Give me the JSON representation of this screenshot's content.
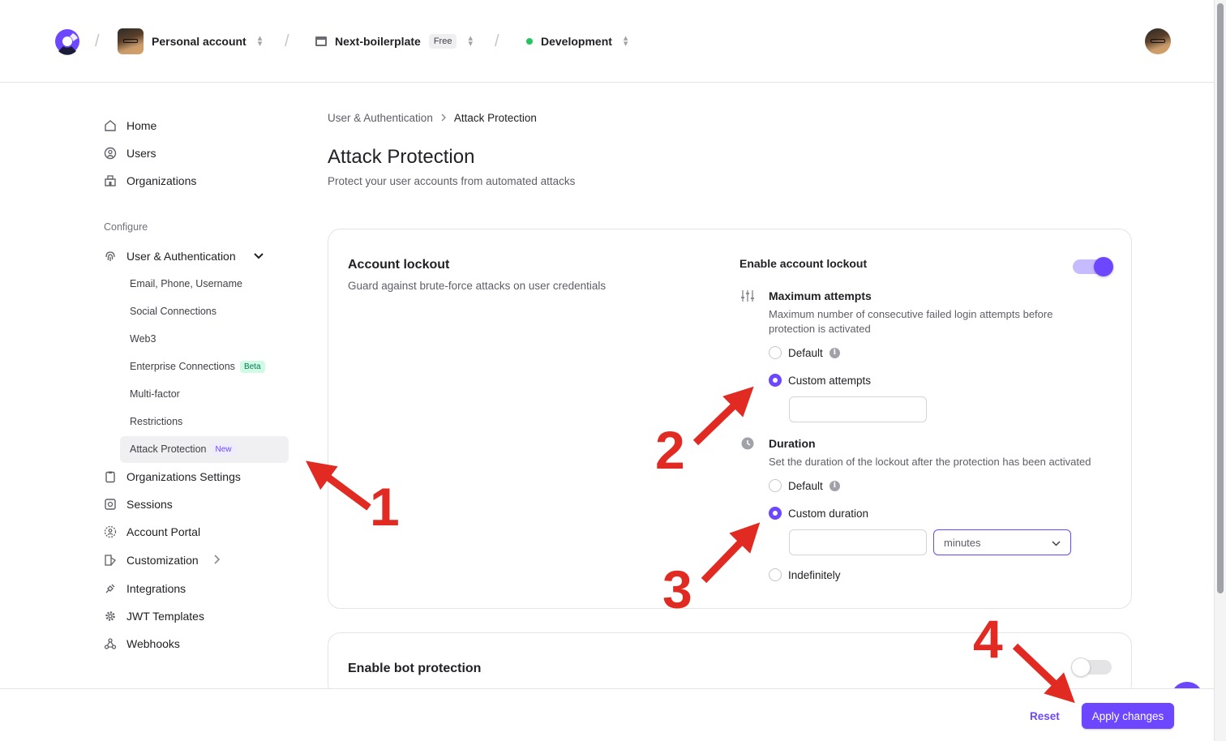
{
  "topbar": {
    "account_label": "Personal account",
    "project_label": "Next-boilerplate",
    "plan_badge": "Free",
    "environment_label": "Development",
    "environment_color": "#22c55e"
  },
  "sidebar": {
    "items": [
      {
        "label": "Home",
        "icon": "home-icon"
      },
      {
        "label": "Users",
        "icon": "user-circle-icon"
      },
      {
        "label": "Organizations",
        "icon": "building-icon"
      }
    ],
    "configure_label": "Configure",
    "user_auth_label": "User & Authentication",
    "sub_items": [
      {
        "label": "Email, Phone, Username"
      },
      {
        "label": "Social Connections"
      },
      {
        "label": "Web3"
      },
      {
        "label": "Enterprise Connections",
        "badge": "Beta"
      },
      {
        "label": "Multi-factor"
      },
      {
        "label": "Restrictions"
      },
      {
        "label": "Attack Protection",
        "badge": "New"
      }
    ],
    "more_items": [
      {
        "label": "Organizations Settings",
        "icon": "clipboard-icon"
      },
      {
        "label": "Sessions",
        "icon": "sessions-icon"
      },
      {
        "label": "Account Portal",
        "icon": "portal-icon"
      },
      {
        "label": "Customization",
        "icon": "brush-icon"
      },
      {
        "label": "Integrations",
        "icon": "plug-icon"
      },
      {
        "label": "JWT Templates",
        "icon": "gear-icon"
      },
      {
        "label": "Webhooks",
        "icon": "webhook-icon"
      }
    ]
  },
  "main": {
    "breadcrumb_parent": "User & Authentication",
    "breadcrumb_current": "Attack Protection",
    "title": "Attack Protection",
    "subtitle": "Protect your user accounts from automated attacks",
    "lockout": {
      "title": "Account lockout",
      "subtitle": "Guard against brute-force attacks on user credentials",
      "enable_label": "Enable account lockout",
      "enabled": true,
      "max_attempts": {
        "title": "Maximum attempts",
        "desc": "Maximum number of consecutive failed login attempts before protection is activated",
        "default_label": "Default",
        "custom_label": "Custom attempts",
        "value": ""
      },
      "duration": {
        "title": "Duration",
        "desc": "Set the duration of the lockout after the protection has been activated",
        "default_label": "Default",
        "custom_label": "Custom duration",
        "indefinitely_label": "Indefinitely",
        "value": "",
        "unit": "minutes"
      }
    },
    "bot": {
      "title": "Enable bot protection",
      "enabled": false
    }
  },
  "footer": {
    "reset_label": "Reset",
    "apply_label": "Apply changes"
  },
  "annotations": [
    "1",
    "2",
    "3",
    "4"
  ],
  "colors": {
    "accent": "#6c47ff",
    "annotation": "#e12a21"
  }
}
